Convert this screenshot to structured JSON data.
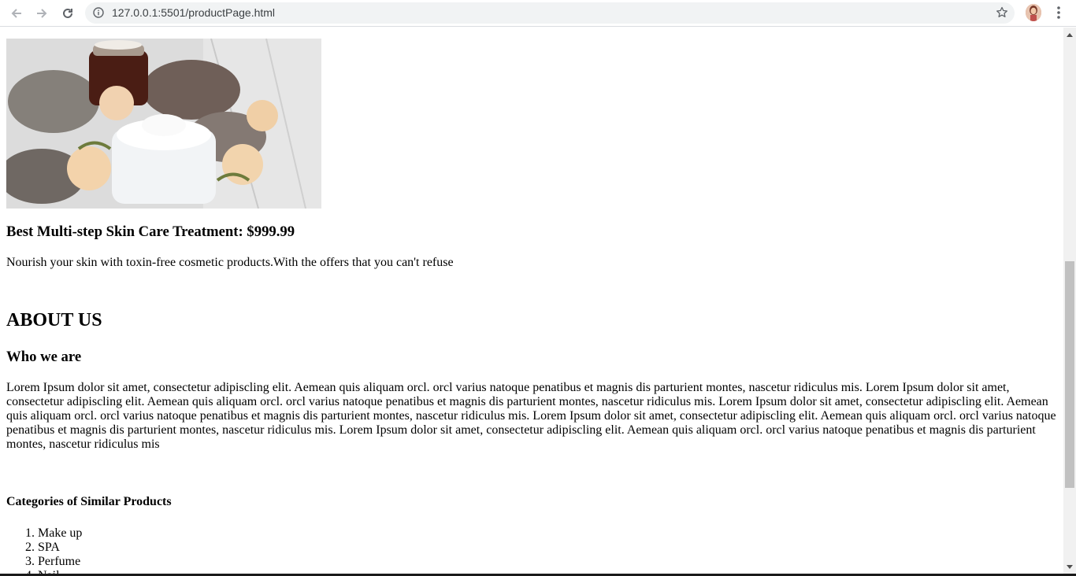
{
  "browser": {
    "url": "127.0.0.1:5501/productPage.html",
    "icons": {
      "back": "arrow-left-icon",
      "forward": "arrow-right-icon",
      "reload": "reload-icon",
      "info": "info-icon",
      "bookmark": "star-icon",
      "menu": "kebab-menu-icon"
    }
  },
  "product": {
    "title": "Best Multi-step Skin Care Treatment: $999.99",
    "description": "Nourish your skin with toxin-free cosmetic products.With the offers that you can't refuse"
  },
  "about": {
    "heading": "ABOUT US",
    "subheading": "Who we are",
    "body": "Lorem Ipsum dolor sit amet, consectetur adipiscling elit. Aemean quis aliquam orcl. orcl varius natoque penatibus et magnis dis parturient montes, nascetur ridiculus mis. Lorem Ipsum dolor sit amet, consectetur adipiscling elit. Aemean quis aliquam orcl. orcl varius natoque penatibus et magnis dis parturient montes, nascetur ridiculus mis. Lorem Ipsum dolor sit amet, consectetur adipiscling elit. Aemean quis aliquam orcl. orcl varius natoque penatibus et magnis dis parturient montes, nascetur ridiculus mis. Lorem Ipsum dolor sit amet, consectetur adipiscling elit. Aemean quis aliquam orcl. orcl varius natoque penatibus et magnis dis parturient montes, nascetur ridiculus mis. Lorem Ipsum dolor sit amet, consectetur adipiscling elit. Aemean quis aliquam orcl. orcl varius natoque penatibus et magnis dis parturient montes, nascetur ridiculus mis"
  },
  "categories": {
    "heading": "Categories of Similar Products",
    "items": [
      "Make up",
      "SPA",
      "Perfume",
      "Nail"
    ]
  }
}
